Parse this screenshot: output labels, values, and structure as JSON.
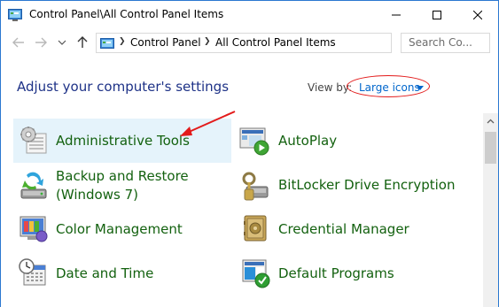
{
  "window": {
    "title": "Control Panel\\All Control Panel Items"
  },
  "address": {
    "crumbs": [
      "Control Panel",
      "All Control Panel Items"
    ],
    "search_placeholder": "Search Co..."
  },
  "header": {
    "title": "Adjust your computer's settings",
    "view_by_label": "View by:",
    "view_by_value": "Large icons"
  },
  "items": [
    {
      "label": "Administrative Tools",
      "icon": "administrative-tools-icon",
      "highlighted": true
    },
    {
      "label": "AutoPlay",
      "icon": "autoplay-icon"
    },
    {
      "label": "Backup and Restore",
      "label2": "(Windows 7)",
      "icon": "backup-restore-icon"
    },
    {
      "label": "BitLocker Drive Encryption",
      "icon": "bitlocker-icon"
    },
    {
      "label": "Color Management",
      "icon": "color-management-icon"
    },
    {
      "label": "Credential Manager",
      "icon": "credential-manager-icon"
    },
    {
      "label": "Date and Time",
      "icon": "date-time-icon"
    },
    {
      "label": "Default Programs",
      "icon": "default-programs-icon"
    }
  ],
  "colors": {
    "heading": "#1e3287",
    "item_text": "#13610f",
    "link": "#0066cc",
    "highlight": "#e5f3fb",
    "annotation": "#e31b1b"
  }
}
